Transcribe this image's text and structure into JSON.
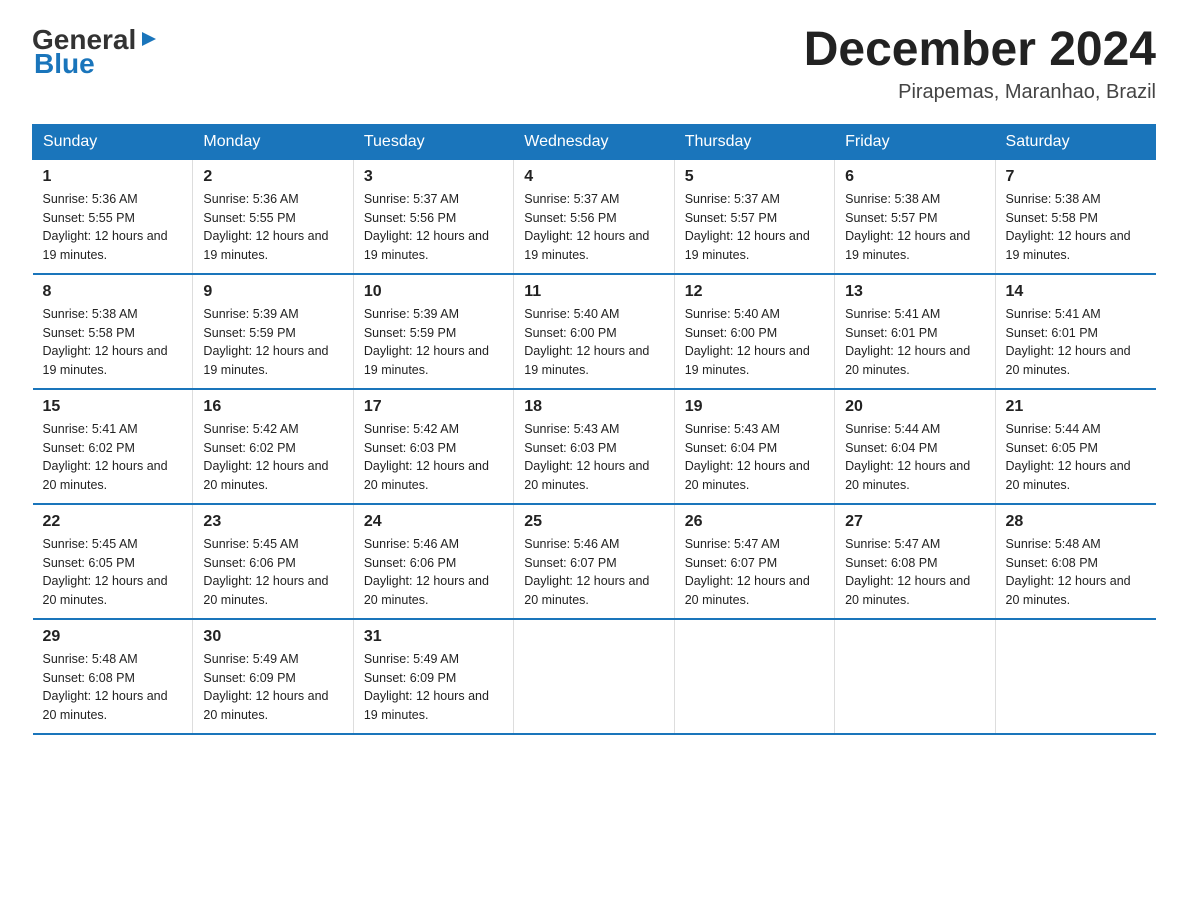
{
  "logo": {
    "general": "General",
    "blue": "Blue"
  },
  "title": {
    "month": "December 2024",
    "location": "Pirapemas, Maranhao, Brazil"
  },
  "headers": [
    "Sunday",
    "Monday",
    "Tuesday",
    "Wednesday",
    "Thursday",
    "Friday",
    "Saturday"
  ],
  "weeks": [
    [
      {
        "day": "1",
        "sunrise": "5:36 AM",
        "sunset": "5:55 PM",
        "daylight": "12 hours and 19 minutes."
      },
      {
        "day": "2",
        "sunrise": "5:36 AM",
        "sunset": "5:55 PM",
        "daylight": "12 hours and 19 minutes."
      },
      {
        "day": "3",
        "sunrise": "5:37 AM",
        "sunset": "5:56 PM",
        "daylight": "12 hours and 19 minutes."
      },
      {
        "day": "4",
        "sunrise": "5:37 AM",
        "sunset": "5:56 PM",
        "daylight": "12 hours and 19 minutes."
      },
      {
        "day": "5",
        "sunrise": "5:37 AM",
        "sunset": "5:57 PM",
        "daylight": "12 hours and 19 minutes."
      },
      {
        "day": "6",
        "sunrise": "5:38 AM",
        "sunset": "5:57 PM",
        "daylight": "12 hours and 19 minutes."
      },
      {
        "day": "7",
        "sunrise": "5:38 AM",
        "sunset": "5:58 PM",
        "daylight": "12 hours and 19 minutes."
      }
    ],
    [
      {
        "day": "8",
        "sunrise": "5:38 AM",
        "sunset": "5:58 PM",
        "daylight": "12 hours and 19 minutes."
      },
      {
        "day": "9",
        "sunrise": "5:39 AM",
        "sunset": "5:59 PM",
        "daylight": "12 hours and 19 minutes."
      },
      {
        "day": "10",
        "sunrise": "5:39 AM",
        "sunset": "5:59 PM",
        "daylight": "12 hours and 19 minutes."
      },
      {
        "day": "11",
        "sunrise": "5:40 AM",
        "sunset": "6:00 PM",
        "daylight": "12 hours and 19 minutes."
      },
      {
        "day": "12",
        "sunrise": "5:40 AM",
        "sunset": "6:00 PM",
        "daylight": "12 hours and 19 minutes."
      },
      {
        "day": "13",
        "sunrise": "5:41 AM",
        "sunset": "6:01 PM",
        "daylight": "12 hours and 20 minutes."
      },
      {
        "day": "14",
        "sunrise": "5:41 AM",
        "sunset": "6:01 PM",
        "daylight": "12 hours and 20 minutes."
      }
    ],
    [
      {
        "day": "15",
        "sunrise": "5:41 AM",
        "sunset": "6:02 PM",
        "daylight": "12 hours and 20 minutes."
      },
      {
        "day": "16",
        "sunrise": "5:42 AM",
        "sunset": "6:02 PM",
        "daylight": "12 hours and 20 minutes."
      },
      {
        "day": "17",
        "sunrise": "5:42 AM",
        "sunset": "6:03 PM",
        "daylight": "12 hours and 20 minutes."
      },
      {
        "day": "18",
        "sunrise": "5:43 AM",
        "sunset": "6:03 PM",
        "daylight": "12 hours and 20 minutes."
      },
      {
        "day": "19",
        "sunrise": "5:43 AM",
        "sunset": "6:04 PM",
        "daylight": "12 hours and 20 minutes."
      },
      {
        "day": "20",
        "sunrise": "5:44 AM",
        "sunset": "6:04 PM",
        "daylight": "12 hours and 20 minutes."
      },
      {
        "day": "21",
        "sunrise": "5:44 AM",
        "sunset": "6:05 PM",
        "daylight": "12 hours and 20 minutes."
      }
    ],
    [
      {
        "day": "22",
        "sunrise": "5:45 AM",
        "sunset": "6:05 PM",
        "daylight": "12 hours and 20 minutes."
      },
      {
        "day": "23",
        "sunrise": "5:45 AM",
        "sunset": "6:06 PM",
        "daylight": "12 hours and 20 minutes."
      },
      {
        "day": "24",
        "sunrise": "5:46 AM",
        "sunset": "6:06 PM",
        "daylight": "12 hours and 20 minutes."
      },
      {
        "day": "25",
        "sunrise": "5:46 AM",
        "sunset": "6:07 PM",
        "daylight": "12 hours and 20 minutes."
      },
      {
        "day": "26",
        "sunrise": "5:47 AM",
        "sunset": "6:07 PM",
        "daylight": "12 hours and 20 minutes."
      },
      {
        "day": "27",
        "sunrise": "5:47 AM",
        "sunset": "6:08 PM",
        "daylight": "12 hours and 20 minutes."
      },
      {
        "day": "28",
        "sunrise": "5:48 AM",
        "sunset": "6:08 PM",
        "daylight": "12 hours and 20 minutes."
      }
    ],
    [
      {
        "day": "29",
        "sunrise": "5:48 AM",
        "sunset": "6:08 PM",
        "daylight": "12 hours and 20 minutes."
      },
      {
        "day": "30",
        "sunrise": "5:49 AM",
        "sunset": "6:09 PM",
        "daylight": "12 hours and 20 minutes."
      },
      {
        "day": "31",
        "sunrise": "5:49 AM",
        "sunset": "6:09 PM",
        "daylight": "12 hours and 19 minutes."
      },
      null,
      null,
      null,
      null
    ]
  ]
}
